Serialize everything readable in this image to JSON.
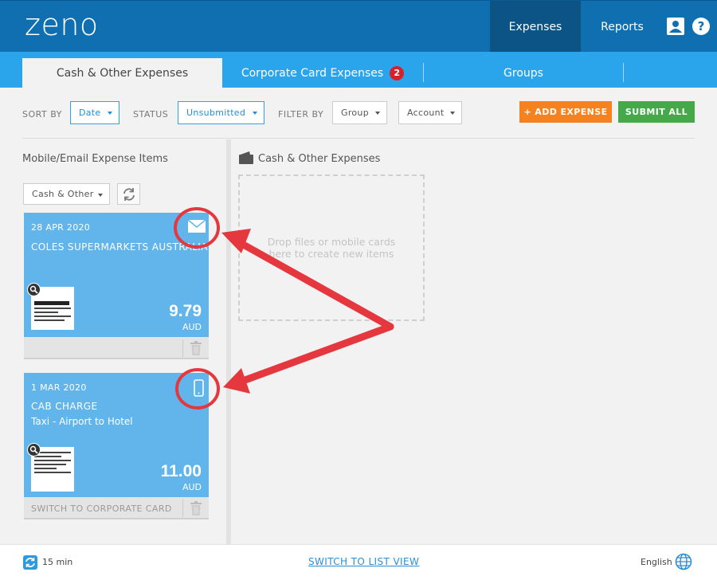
{
  "header": {
    "logo": "zeno",
    "nav": [
      {
        "label": "Expenses",
        "active": true
      },
      {
        "label": "Reports",
        "active": false
      }
    ],
    "help_label": "?"
  },
  "tabs": [
    {
      "label": "Cash & Other Expenses",
      "active": true
    },
    {
      "label": "Corporate Card Expenses",
      "badge": "2"
    },
    {
      "label": "Groups"
    }
  ],
  "toolbar": {
    "sort_by_label": "SORT BY",
    "sort_value": "Date",
    "status_label": "STATUS",
    "status_value": "Unsubmitted",
    "filter_label": "FILTER BY",
    "group_value": "Group",
    "account_value": "Account",
    "add_expense": "+ ADD EXPENSE",
    "submit_all": "SUBMIT ALL"
  },
  "left": {
    "title": "Mobile/Email Expense Items",
    "filter_value": "Cash & Other",
    "cards": [
      {
        "date": "28 APR 2020",
        "merchant": "COLES SUPERMARKETS AUSTRALIA",
        "description": "",
        "amount": "9.79",
        "currency": "AUD",
        "source_icon": "email-icon",
        "footer_text": ""
      },
      {
        "date": "1 MAR 2020",
        "merchant": "CAB CHARGE",
        "description": "Taxi - Airport to Hotel",
        "amount": "11.00",
        "currency": "AUD",
        "source_icon": "mobile-icon",
        "footer_text": "SWITCH TO CORPORATE CARD"
      }
    ]
  },
  "right": {
    "title": "Cash & Other Expenses",
    "dropzone_text": "Drop files or mobile cards here to create new items"
  },
  "footer": {
    "sync_text": "15 min",
    "list_view": "SWITCH TO LIST VIEW",
    "language": "English"
  },
  "colors": {
    "header_bg": "#0f6fb0",
    "tab_bg": "#2aa4ea",
    "card_bg": "#62b5ea",
    "add_btn": "#f5821f",
    "submit_btn": "#45a94a",
    "annotation": "#e5383e"
  }
}
